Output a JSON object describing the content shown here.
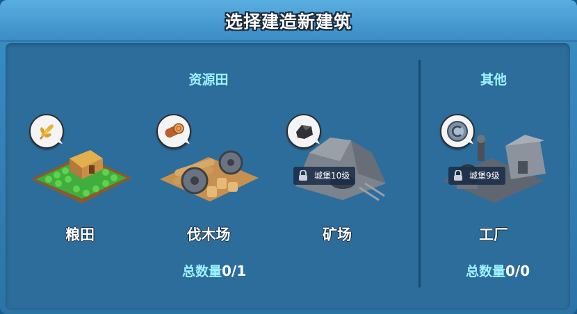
{
  "dialog": {
    "title": "选择建造新建筑"
  },
  "sections": {
    "resource": {
      "title": "资源田",
      "count_label": "总数量",
      "count_value": "0/1"
    },
    "other": {
      "title": "其他",
      "count_label": "总数量",
      "count_value": "0/0"
    }
  },
  "buildings": [
    {
      "name": "粮田",
      "icon": "wheat-icon",
      "locked": false,
      "lock_text": ""
    },
    {
      "name": "伐木场",
      "icon": "log-icon",
      "locked": false,
      "lock_text": ""
    },
    {
      "name": "矿场",
      "icon": "ore-icon",
      "locked": true,
      "lock_text": "城堡10级"
    },
    {
      "name": "工厂",
      "icon": "gear-coin-icon",
      "locked": true,
      "lock_text": "城堡9级"
    }
  ],
  "colors": {
    "accent_text": "#9ff3ff",
    "panel": "#2c6d9c",
    "titlebar": "#4aa0d6"
  }
}
